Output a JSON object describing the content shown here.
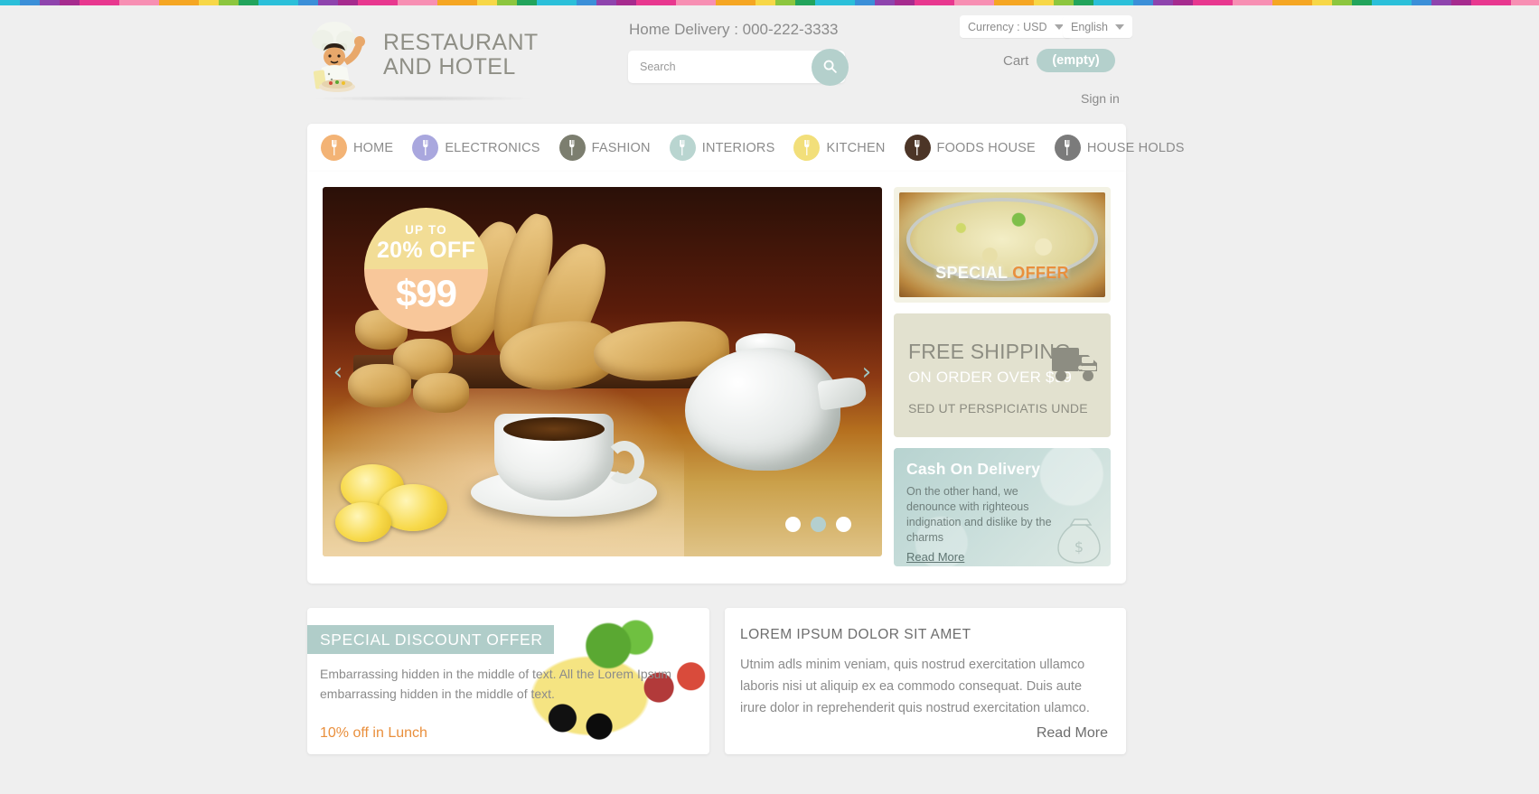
{
  "header": {
    "logo": {
      "line1": "RESTAURANT",
      "line2": "AND HOTEL",
      "icon": "chef-icon"
    },
    "delivery": "Home Delivery : 000-222-3333",
    "search": {
      "placeholder": "Search",
      "value": "",
      "icon": "search-icon"
    },
    "currency": {
      "label": "Currency : USD"
    },
    "language": {
      "label": "English"
    },
    "cart": {
      "label": "Cart",
      "badge": "(empty)"
    },
    "signin": "Sign in"
  },
  "nav": {
    "items": [
      {
        "label": "HOME",
        "color": "#f3b375",
        "icon": "fork-icon"
      },
      {
        "label": "ELECTRONICS",
        "color": "#a9a7de",
        "icon": "fork-icon"
      },
      {
        "label": "FASHION",
        "color": "#7c7e6f",
        "icon": "fork-icon"
      },
      {
        "label": "INTERIORS",
        "color": "#b9d5d0",
        "icon": "fork-icon"
      },
      {
        "label": "KITCHEN",
        "color": "#f2df7a",
        "icon": "fork-icon"
      },
      {
        "label": "FOODS HOUSE",
        "color": "#4c3527",
        "icon": "fork-icon"
      },
      {
        "label": "HOUSE HOLDS",
        "color": "#7b7b7b",
        "icon": "fork-icon"
      }
    ]
  },
  "slider": {
    "badge": {
      "upto": "UP TO",
      "percent": "20% OFF",
      "price": "$99"
    },
    "prev": "‹",
    "next": "›",
    "dots": [
      {
        "active": false
      },
      {
        "active": true
      },
      {
        "active": false
      }
    ]
  },
  "side": {
    "special_offer": {
      "word1": "SPECIAL",
      "word2": "OFFER"
    },
    "shipping": {
      "line1": "FREE SHIPPING",
      "line2": "ON ORDER OVER $99",
      "line3": "SED UT PERSPICIATIS UNDE",
      "icon": "truck-icon"
    },
    "cod": {
      "title": "Cash On Delivery",
      "body": "On the other hand, we denounce with righteous indignation and dislike by the charms",
      "link": "Read More",
      "icon": "money-bag-icon"
    }
  },
  "bottom": {
    "discount": {
      "banner": "SPECIAL DISCOUNT OFFER",
      "body": "Embarrassing hidden in the middle of text. All the Lorem Ipsum embarrassing hidden in the middle of text.",
      "cta": "10% off in Lunch"
    },
    "lorem": {
      "title": "LOREM IPSUM DOLOR SIT AMET",
      "body": "Utnim adls minim veniam, quis nostrud exercitation ullamco laboris nisi ut aliquip ex ea commodo consequat. Duis aute irure dolor in reprehenderit quis nostrud exercitation ulamco.",
      "link": "Read More"
    }
  },
  "colors": {
    "accent_teal": "#b4d0cc",
    "accent_orange": "#e98f3c",
    "page_bg": "#efefef",
    "text_gray": "#8b8b8b"
  }
}
